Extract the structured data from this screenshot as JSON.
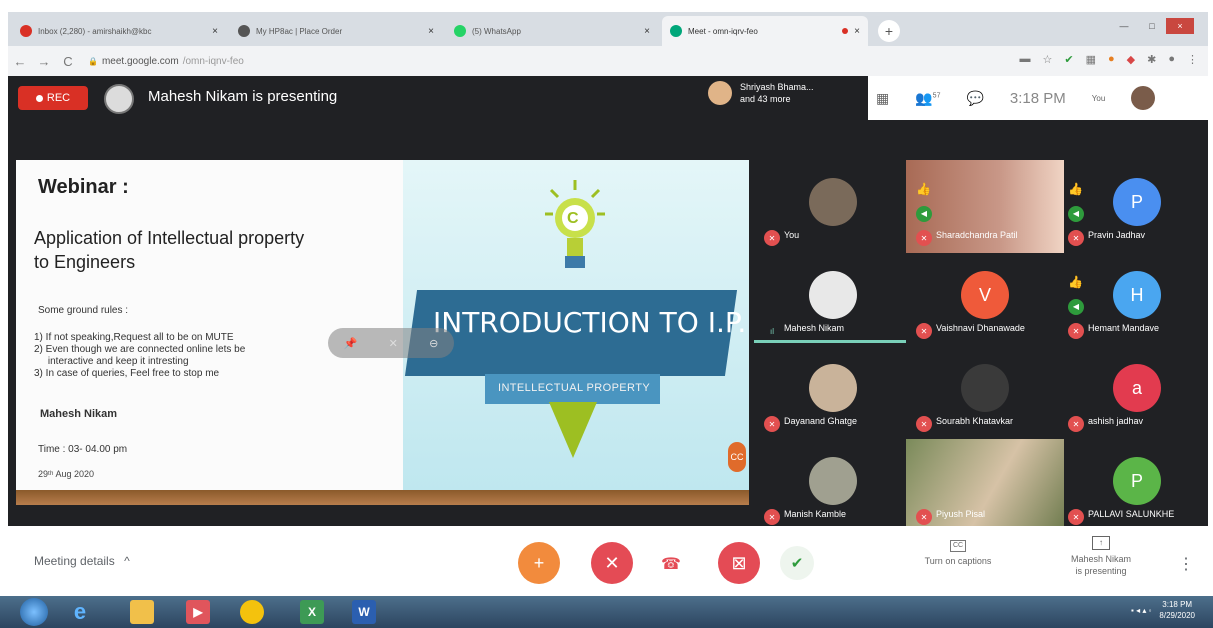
{
  "browser": {
    "tabs": [
      {
        "title": "Inbox (2,280) - amirshaikh@kbc",
        "close": "×",
        "active": false,
        "color": "#d93025"
      },
      {
        "title": "My HP8ac | Place Order",
        "close": "×",
        "active": false,
        "color": "#555555"
      },
      {
        "title": "(5) WhatsApp",
        "close": "×",
        "active": false,
        "color": "#25d366"
      },
      {
        "title": "Meet - omn-iqrv-feo",
        "close": "×",
        "active": true,
        "color": "#00a77a"
      }
    ],
    "new_tab": "+",
    "url_host": "meet.google.com",
    "url_path": "/omn-iqnv-feo",
    "back": "←",
    "forward": "→",
    "reload": "C",
    "lock": "🔒",
    "window_controls": [
      "—",
      "□",
      "×"
    ]
  },
  "meet": {
    "rec_label": "REC",
    "presenter_text": "Mahesh Nikam is presenting",
    "viewers_line1": "Shriyash Bhama...",
    "viewers_line2": "and 43 more",
    "participant_count": "57",
    "time": "3:18 PM",
    "you_label": "You"
  },
  "slide": {
    "webinar": "Webinar :",
    "title_line1": "Application of Intellectual property",
    "title_line2": "to Engineers",
    "rules_heading": "Some ground rules :",
    "rule1": "1)  If not speaking,Request all to be on MUTE",
    "rule2": "2)  Even though we are connected online lets be",
    "rule2b": "     interactive and keep it intresting",
    "rule3": "3) In case of queries, Feel free to stop me",
    "speaker": "Mahesh Nikam",
    "time": "Time : 03- 04.00 pm",
    "date": "29ᵗʰ Aug 2020",
    "banner_title": "INTRODUCTION TO I.P.",
    "banner_sub": "INTELLECTUAL PROPERTY",
    "cc": "CC",
    "bulb_letter": "C"
  },
  "participants": [
    {
      "name": "You",
      "avatar": "",
      "color": "#7a6a5a",
      "muted": true
    },
    {
      "name": "Sharadchandra Patil",
      "avatar": "",
      "color": "#8a4a38",
      "muted": true,
      "thumb": true,
      "talking": true
    },
    {
      "name": "Pravin Jadhav",
      "avatar": "P",
      "color": "#4a8ff0",
      "muted": true,
      "thumb": true,
      "talking": true
    },
    {
      "name": "Mahesh Nikam",
      "avatar": "",
      "color": "#e8e8e8",
      "muted": false
    },
    {
      "name": "Vaishnavi Dhanawade",
      "avatar": "V",
      "color": "#ef5a3a",
      "muted": true
    },
    {
      "name": "Hemant Mandave",
      "avatar": "H",
      "color": "#4aa6f0",
      "muted": true,
      "thumb": true,
      "talking": true
    },
    {
      "name": "Dayanand Ghatge",
      "avatar": "",
      "color": "#c9b39a",
      "muted": true
    },
    {
      "name": "Sourabh Khatavkar",
      "avatar": "",
      "color": "#3a3a3a",
      "muted": true
    },
    {
      "name": "ashish jadhav",
      "avatar": "a",
      "color": "#e23b4f",
      "muted": true
    },
    {
      "name": "Manish Kamble",
      "avatar": "",
      "color": "#a0a090",
      "muted": true
    },
    {
      "name": "Piyush Pisal",
      "avatar": "",
      "color": "#7a8a5a",
      "muted": true
    },
    {
      "name": "PALLAVI SALUNKHE",
      "avatar": "P",
      "color": "#5bb548",
      "muted": true
    }
  ],
  "bottom": {
    "meeting_details": "Meeting details",
    "chevron": "^",
    "captions": "Turn on captions",
    "present_line1": "Mahesh Nikam",
    "present_line2": "is presenting",
    "more": "⋮"
  },
  "taskbar": {
    "clock_time": "3:18 PM",
    "clock_date": "8/29/2020",
    "apps": [
      "e",
      "📁",
      "▶",
      "◉",
      "X",
      "W"
    ]
  }
}
